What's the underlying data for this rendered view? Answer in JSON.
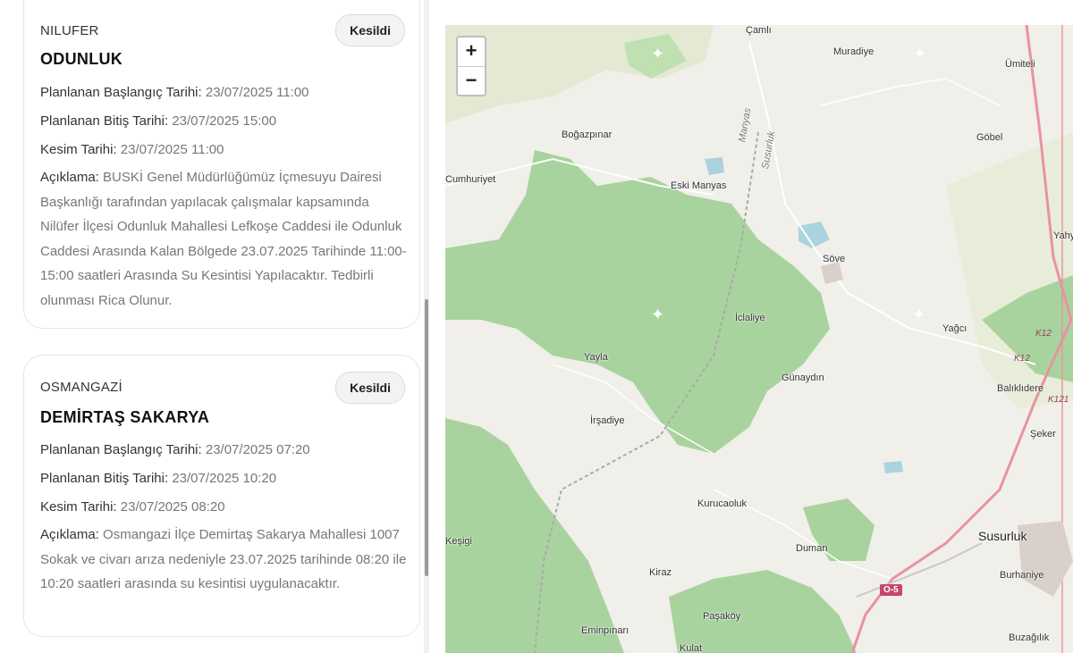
{
  "outages": [
    {
      "district": "NILUFER",
      "status": "Kesildi",
      "neighborhood": "ODUNLUK",
      "planned_start_label": "Planlanan Başlangıç Tarihi:",
      "planned_start": "23/07/2025 11:00",
      "planned_end_label": "Planlanan Bitiş Tarihi:",
      "planned_end": "23/07/2025 15:00",
      "cut_label": "Kesim Tarihi:",
      "cut_date": "23/07/2025 11:00",
      "description_label": "Açıklama:",
      "description": "BUSKİ Genel Müdürlüğümüz İçmesuyu Dairesi Başkanlığı tarafından yapılacak çalışmalar kapsamında Nilüfer İlçesi Odunluk Mahallesi Lefkoşe Caddesi ile Odunluk Caddesi Arasında Kalan Bölgede 23.07.2025 Tarihinde 11:00-15:00 saatleri Arasında Su Kesintisi Yapılacaktır. Tedbirli olunması Rica Olunur."
    },
    {
      "district": "OSMANGAZİ",
      "status": "Kesildi",
      "neighborhood": "DEMİRTAŞ SAKARYA",
      "planned_start_label": "Planlanan Başlangıç Tarihi:",
      "planned_start": "23/07/2025 07:20",
      "planned_end_label": "Planlanan Bitiş Tarihi:",
      "planned_end": "23/07/2025 10:20",
      "cut_label": "Kesim Tarihi:",
      "cut_date": "23/07/2025 08:20",
      "description_label": "Açıklama:",
      "description": "Osmangazi İlçe Demirtaş Sakarya Mahallesi 1007 Sokak ve civarı arıza nedeniyle 23.07.2025 tarihinde 08:20 ile 10:20 saatleri arasında su kesintisi uygulanacaktır."
    }
  ],
  "map": {
    "zoom_in": "+",
    "zoom_out": "−",
    "places": {
      "camli": "Çamlı",
      "muradiye": "Muradiye",
      "umiteli": "Ümiteli",
      "bogazpinar": "Boğazpınar",
      "gobel": "Göbel",
      "cumhuriyet": "Cumhuriyet",
      "eski_manyas": "Eski Manyas",
      "yahy": "Yahy",
      "sove": "Söve",
      "iclaliye": "İclaliye",
      "yagci": "Yağcı",
      "yayla": "Yayla",
      "gunaydin": "Günaydın",
      "balikli": "Balıklıdere",
      "irsadiye": "İrşadiye",
      "seker": "Şeker",
      "kurucaoluk": "Kurucaoluk",
      "kesigi": "Keşigi",
      "duman": "Duman",
      "susurluk": "Susurluk",
      "burhaniye": "Burhaniye",
      "kiraz": "Kiraz",
      "pasakoy": "Paşaköy",
      "eminpinari": "Eminpınarı",
      "kulat": "Kulat",
      "buzagilik": "Buzağılık",
      "manyas_road": "Manyas",
      "susurluk_road": "Susurluk"
    },
    "road_refs": {
      "o5": "O-5",
      "k12a": "K12",
      "k12b": "K12",
      "k121": "K121"
    },
    "colors": {
      "forest": "#a9d39e",
      "water": "#aad3df",
      "motorway": "#e892a2",
      "land": "#f1efe9"
    }
  }
}
